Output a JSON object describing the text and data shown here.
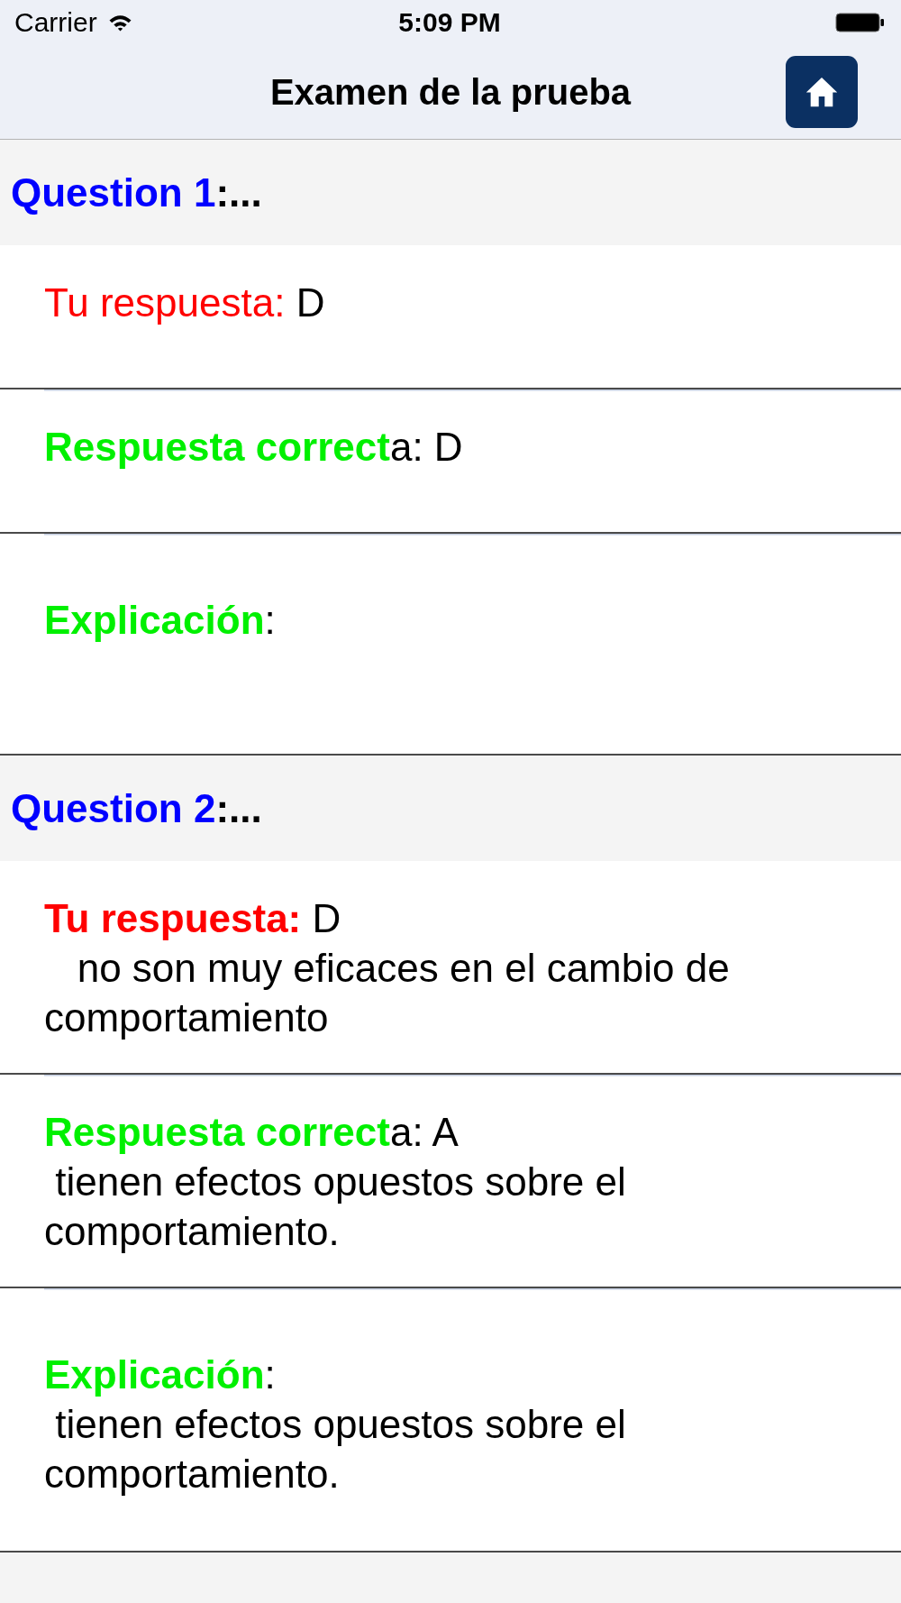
{
  "status_bar": {
    "carrier": "Carrier",
    "time": "5:09 PM"
  },
  "nav_bar": {
    "title": "Examen de la prueba"
  },
  "questions": [
    {
      "title": "Question 1",
      "suffix": ":...",
      "rows": [
        {
          "kind": "your_answer",
          "label": "Tu respuesta:",
          "bold": false,
          "value": " D"
        },
        {
          "kind": "correct_answer",
          "label": "Respuesta correct",
          "bold": true,
          "value": "a: D"
        },
        {
          "kind": "explanation",
          "label": "Explicación",
          "bold": true,
          "value": ":"
        }
      ]
    },
    {
      "title": "Question 2",
      "suffix": ":...",
      "rows": [
        {
          "kind": "your_answer",
          "label": "Tu respuesta:",
          "bold": true,
          "value": " D",
          "detail": "   no son muy eficaces en el cambio de comportamiento"
        },
        {
          "kind": "correct_answer",
          "label": "Respuesta correct",
          "bold": true,
          "value": "a: A",
          "detail": " tienen efectos opuestos sobre el comportamiento."
        },
        {
          "kind": "explanation",
          "label": "Explicación",
          "bold": true,
          "value": ":",
          "detail": " tienen efectos opuestos sobre el comportamiento."
        }
      ]
    }
  ]
}
